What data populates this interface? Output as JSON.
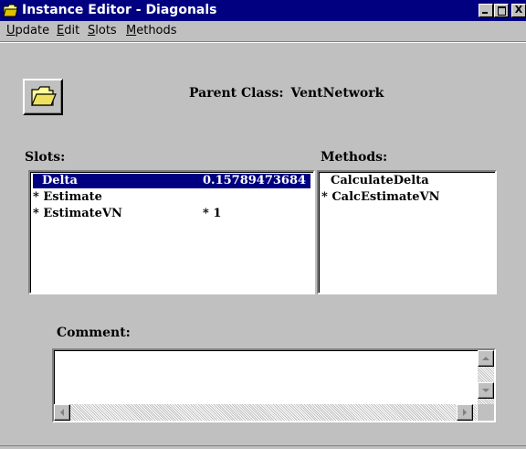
{
  "window": {
    "title": "Instance Editor - Diagonals",
    "close_glyph": "X"
  },
  "menu": {
    "items": [
      {
        "label": "Update",
        "mnemonic": "U"
      },
      {
        "label": "Edit",
        "mnemonic": "E"
      },
      {
        "label": "Slots",
        "mnemonic": "S"
      },
      {
        "label": "Methods",
        "mnemonic": "M"
      }
    ]
  },
  "header": {
    "parent_class_label": "Parent Class:",
    "parent_class_value": "VentNetwork",
    "folder_icon": "open-folder-icon"
  },
  "slots": {
    "label": "Slots:",
    "rows": [
      {
        "name": "Delta",
        "value": "0.15789473684",
        "selected": true
      },
      {
        "name": "* Estimate",
        "value": "",
        "selected": false
      },
      {
        "name": "* EstimateVN",
        "value": "* 1",
        "selected": false
      }
    ]
  },
  "methods": {
    "label": "Methods:",
    "rows": [
      {
        "name": "CalculateDelta"
      },
      {
        "name": "* CalcEstimateVN"
      }
    ]
  },
  "comment": {
    "label": "Comment:",
    "value": ""
  },
  "colors": {
    "titlebar": "#000080",
    "face": "#c0c0c0",
    "selection": "#000080"
  }
}
